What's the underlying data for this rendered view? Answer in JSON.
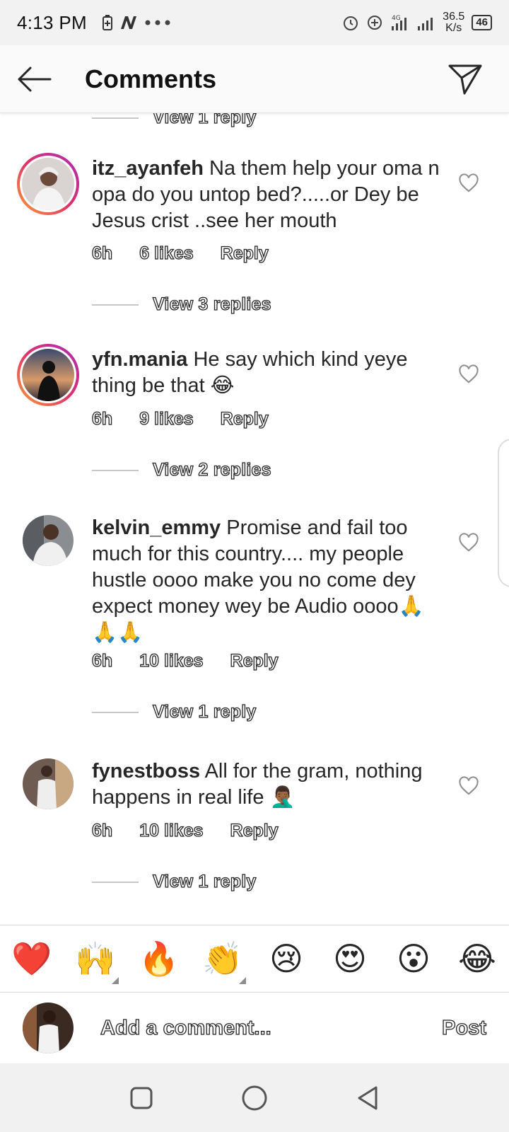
{
  "status_bar": {
    "time": "4:13 PM",
    "network_type": "4G",
    "net_speed_value": "36.5",
    "net_speed_unit": "K/s",
    "battery": "46"
  },
  "header": {
    "title": "Comments",
    "back_icon": "arrow-left-icon",
    "send_icon": "paper-plane-icon"
  },
  "comments": {
    "top_view_replies": "View 1 reply",
    "items": [
      {
        "username": "itz_ayanfeh",
        "text": "Na them help your oma n opa do you untop bed?.....or Dey be Jesus crist ..see her mouth",
        "time": "6h",
        "likes": "6 likes",
        "reply_label": "Reply",
        "view_replies": "View 3 replies"
      },
      {
        "username": "yfn.mania",
        "text": "He say which kind yeye thing be that 😂",
        "time": "6h",
        "likes": "9 likes",
        "reply_label": "Reply",
        "view_replies": "View 2 replies"
      },
      {
        "username": "kelvin_emmy",
        "text": "Promise and fail too much for this country.... my people hustle oooo make you no come dey expect money wey be Audio oooo🙏🙏🙏",
        "time": "6h",
        "likes": "10 likes",
        "reply_label": "Reply",
        "view_replies": "View 1 reply"
      },
      {
        "username": "fynestboss",
        "text": "All for the gram, nothing happens in real life 🤦🏾‍♂️",
        "time": "6h",
        "likes": "10 likes",
        "reply_label": "Reply",
        "view_replies": "View 1 reply"
      }
    ]
  },
  "emoji_bar": {
    "emojis": [
      "❤️",
      "🙌",
      "🔥",
      "👏",
      "😢",
      "😍",
      "😮",
      "😂"
    ]
  },
  "comment_input": {
    "placeholder": "Add a comment...",
    "post_label": "Post"
  },
  "nav_bar": {
    "icons": [
      "recents-square-icon",
      "home-circle-icon",
      "back-triangle-icon"
    ]
  },
  "colors": {
    "text": "#262626",
    "muted": "#8e8e8e",
    "heart_red": "#e0242f",
    "story_ring_start": "#f9a134",
    "story_ring_end": "#a62cb8"
  }
}
